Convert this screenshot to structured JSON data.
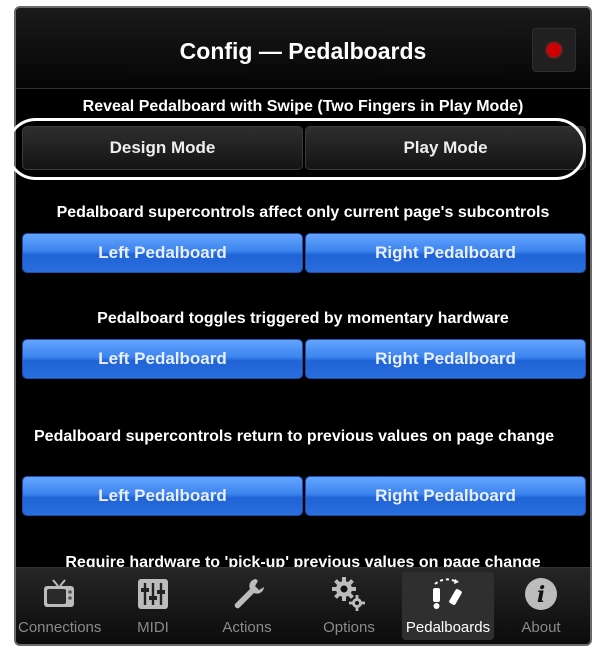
{
  "header": {
    "title": "Config — Pedalboards"
  },
  "sections": {
    "reveal": {
      "label": "Reveal Pedalboard with Swipe (Two Fingers in Play Mode)",
      "btn_left": "Design Mode",
      "btn_right": "Play Mode"
    },
    "supercontrols": {
      "label": "Pedalboard supercontrols affect only current page's subcontrols",
      "btn_left": "Left Pedalboard",
      "btn_right": "Right Pedalboard"
    },
    "toggles": {
      "label": "Pedalboard toggles triggered by momentary hardware",
      "btn_left": "Left Pedalboard",
      "btn_right": "Right Pedalboard"
    },
    "return": {
      "label": "Pedalboard supercontrols return to previous values on page change",
      "btn_left": "Left Pedalboard",
      "btn_right": "Right Pedalboard"
    },
    "pickup": {
      "label": "Require hardware to 'pick-up' previous values on page change"
    }
  },
  "tabs": [
    {
      "label": "Connections",
      "icon": "tv-icon"
    },
    {
      "label": "MIDI",
      "icon": "sliders-icon"
    },
    {
      "label": "Actions",
      "icon": "wrench-icon"
    },
    {
      "label": "Options",
      "icon": "gears-icon"
    },
    {
      "label": "Pedalboards",
      "icon": "pedalboard-icon",
      "active": true
    },
    {
      "label": "About",
      "icon": "info-icon"
    }
  ],
  "colors": {
    "accent_blue": "#3d84ee",
    "record_red": "#d10000"
  }
}
